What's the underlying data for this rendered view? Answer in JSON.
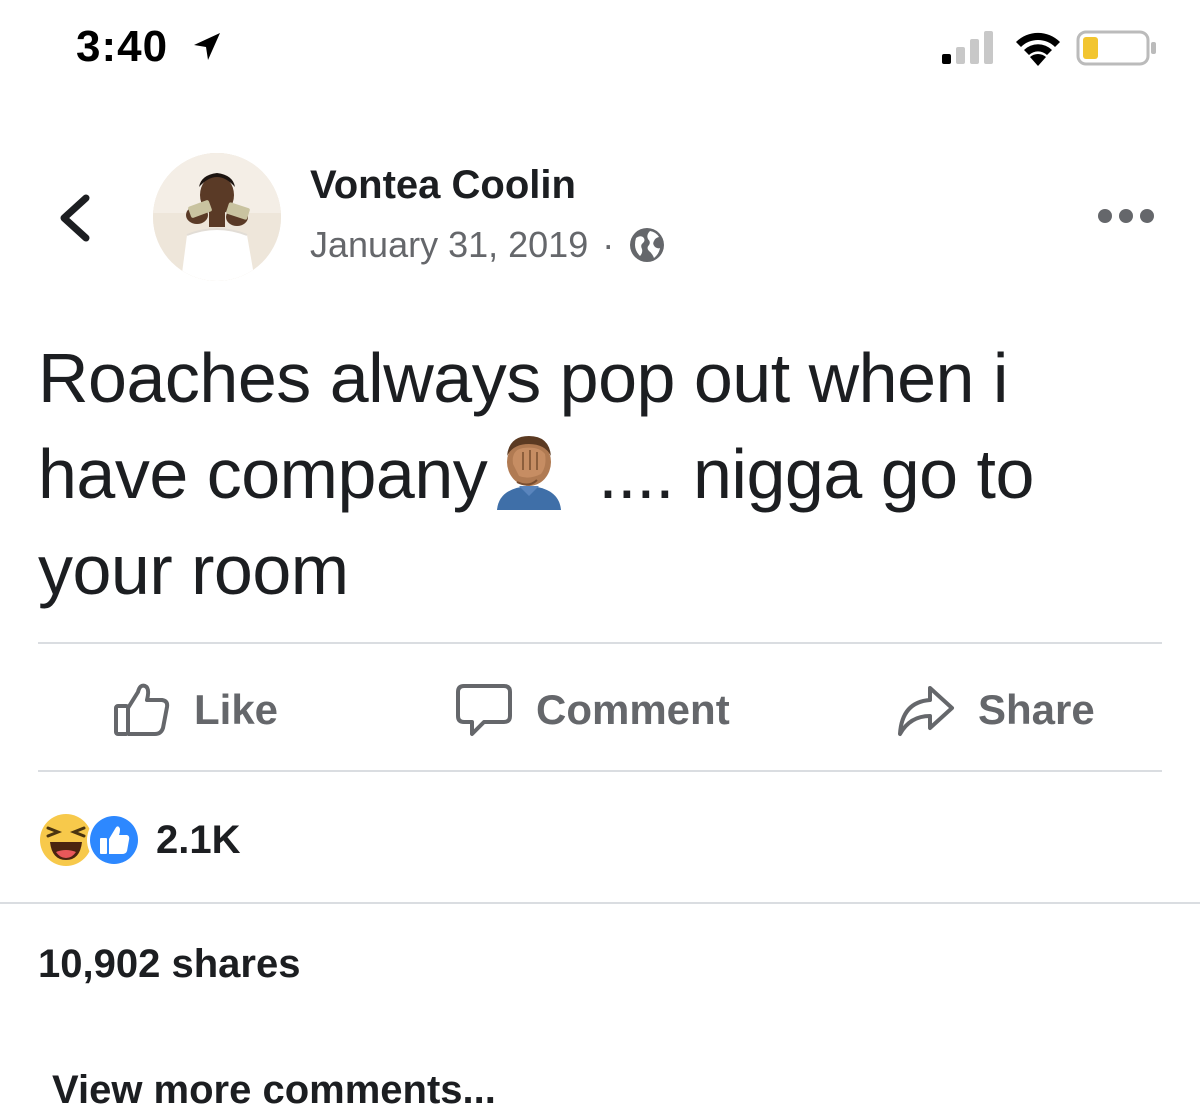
{
  "status_bar": {
    "time": "3:40",
    "icons": [
      "location-arrow-icon",
      "cellular-signal-icon",
      "wifi-icon",
      "battery-icon"
    ]
  },
  "post": {
    "author": "Vontea Coolin",
    "date": "January 31, 2019",
    "separator": "·",
    "privacy_icon": "globe-icon",
    "text_before_emoji": "Roaches always pop out when i have company",
    "emoji": "facepalm-emoji",
    "text_after_emoji": " .... nigga go to your room"
  },
  "actions": {
    "like": "Like",
    "comment": "Comment",
    "share": "Share"
  },
  "reactions": {
    "icons": [
      "haha-reaction-icon",
      "like-reaction-icon"
    ],
    "count": "2.1K"
  },
  "shares": "10,902 shares",
  "view_more": "View more comments..."
}
